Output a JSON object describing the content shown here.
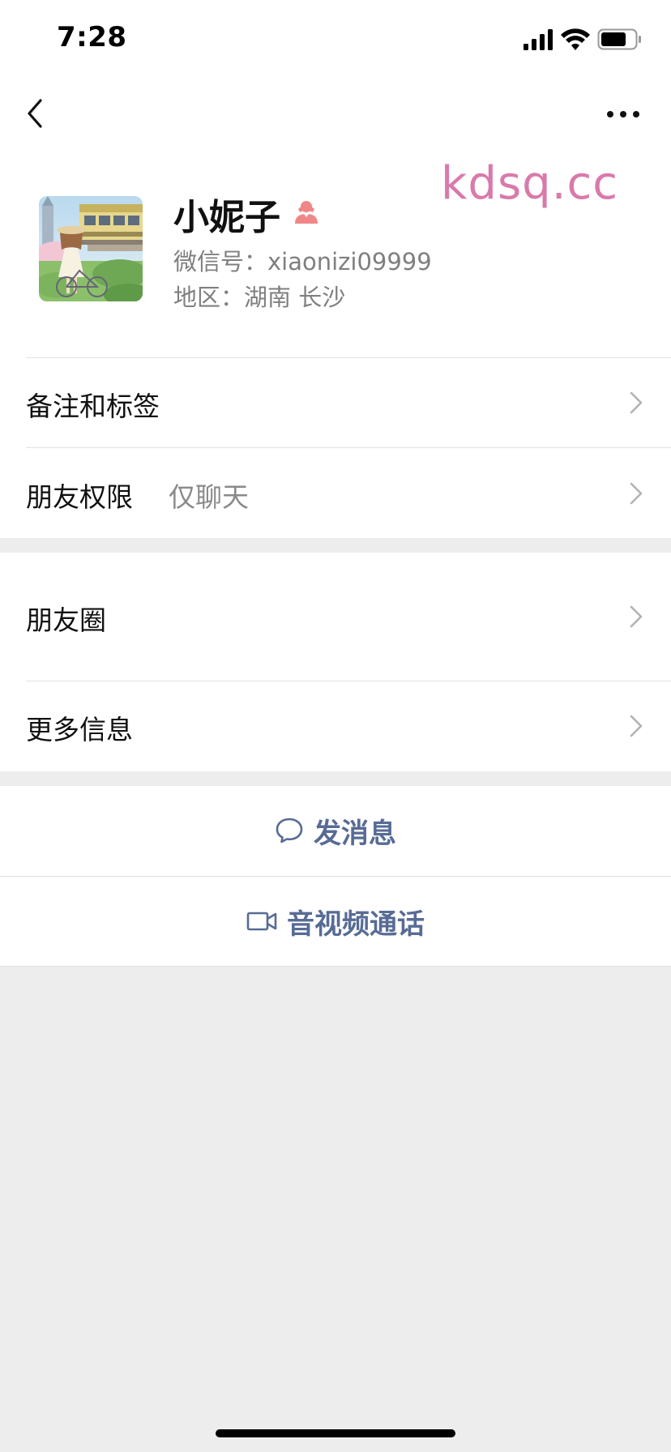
{
  "status_bar": {
    "time": "7:28"
  },
  "profile": {
    "name": "小妮子",
    "wechat_id": "微信号：xiaonizi09999",
    "region": "地区：湖南 长沙",
    "gender_icon": "female-user-icon"
  },
  "watermark": "kdsq.cc",
  "rows": {
    "remark": {
      "label": "备注和标签"
    },
    "permission": {
      "label": "朋友权限",
      "value": "仅聊天"
    },
    "moments": {
      "label": "朋友圈"
    },
    "more_info": {
      "label": "更多信息"
    }
  },
  "actions": {
    "message": {
      "label": "发消息",
      "icon": "chat-bubble-icon"
    },
    "call": {
      "label": "音视频通话",
      "icon": "video-camera-icon"
    }
  },
  "colors": {
    "link": "#576b95",
    "background": "#ededed",
    "watermark": "#d97aab",
    "gender": "#f08787"
  }
}
